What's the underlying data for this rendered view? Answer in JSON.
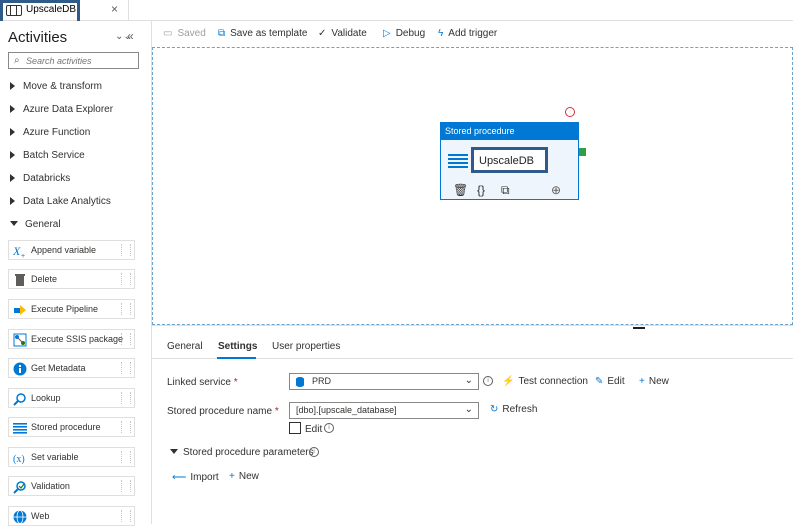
{
  "tab": {
    "title": "UpscaleDB",
    "close": "×"
  },
  "sidebar": {
    "title": "Activities",
    "collapse_all": "⌄⌄",
    "collapse_panel": "«",
    "search_placeholder": "Search activities",
    "categories": [
      {
        "label": "Move & transform"
      },
      {
        "label": "Azure Data Explorer"
      },
      {
        "label": "Azure Function"
      },
      {
        "label": "Batch Service"
      },
      {
        "label": "Databricks"
      },
      {
        "label": "Data Lake Analytics"
      },
      {
        "label": "General"
      }
    ],
    "activities": [
      {
        "label": "Append variable",
        "icon": "append-variable-icon"
      },
      {
        "label": "Delete",
        "icon": "trash-icon"
      },
      {
        "label": "Execute Pipeline",
        "icon": "execute-pipeline-icon"
      },
      {
        "label": "Execute SSIS package",
        "icon": "ssis-icon"
      },
      {
        "label": "Get Metadata",
        "icon": "info-icon"
      },
      {
        "label": "Lookup",
        "icon": "lookup-icon"
      },
      {
        "label": "Stored procedure",
        "icon": "stored-procedure-icon"
      },
      {
        "label": "Set variable",
        "icon": "set-variable-icon"
      },
      {
        "label": "Validation",
        "icon": "validation-icon"
      },
      {
        "label": "Web",
        "icon": "globe-icon"
      }
    ]
  },
  "toolbar": {
    "saved": "Saved",
    "save_as_template": "Save as template",
    "validate": "Validate",
    "debug": "Debug",
    "add_trigger": "Add trigger"
  },
  "node": {
    "type": "Stored procedure",
    "name": "UpscaleDB"
  },
  "panel": {
    "tabs": [
      "General",
      "Settings",
      "User properties"
    ],
    "active_tab": "Settings",
    "linked_service_label": "Linked service",
    "linked_service_value": "PRD",
    "test_connection": "Test connection",
    "edit": "Edit",
    "new": "New",
    "sp_name_label": "Stored procedure name",
    "sp_name_value": "[dbo].[upscale_database]",
    "refresh": "Refresh",
    "edit_checkbox_label": "Edit",
    "params_label": "Stored procedure parameters",
    "import": "Import",
    "new_param": "New",
    "required_mark": "*"
  },
  "colors": {
    "accent": "#0078d4",
    "highlight_box": "#2f5b8a",
    "success_port": "#2f9e44",
    "error_circle": "#d13438"
  }
}
